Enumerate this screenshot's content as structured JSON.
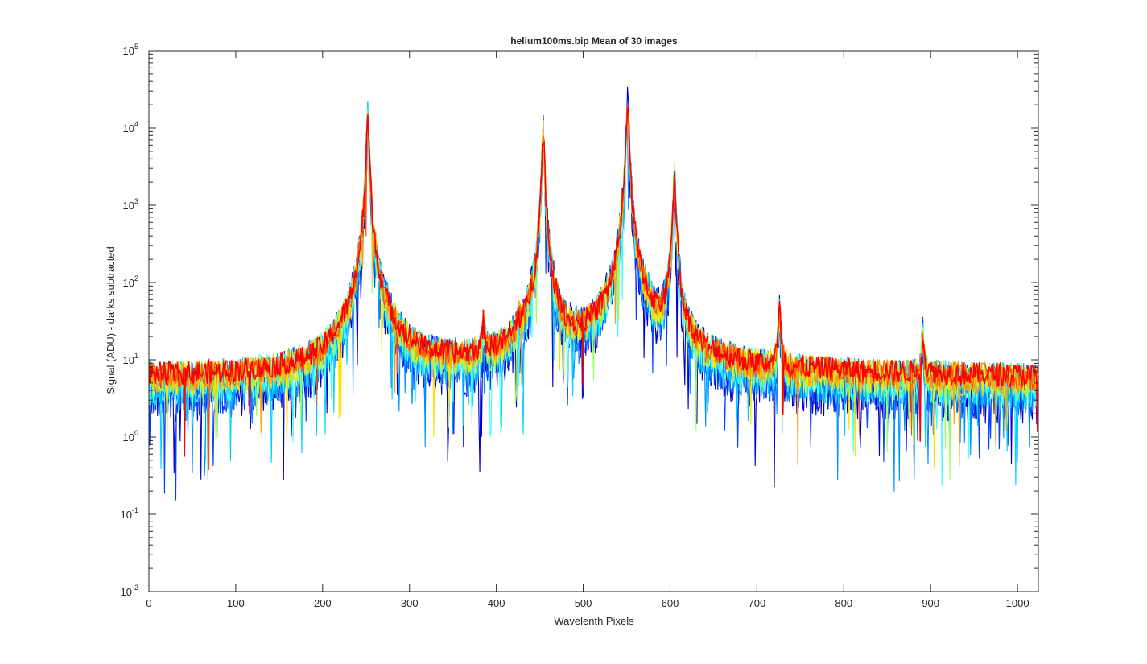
{
  "chart_data": {
    "type": "line",
    "title": "helium100ms.bip  Mean of 30 images",
    "xlabel": "Wavelenth Pixels",
    "ylabel": "Signal (ADU) - darks subtracted",
    "xlim": [
      0,
      1024
    ],
    "ylim": [
      0.01,
      100000
    ],
    "yscale": "log",
    "grid": false,
    "legend": "none",
    "x_ticks": [
      0,
      100,
      200,
      300,
      400,
      500,
      600,
      700,
      800,
      900,
      1000
    ],
    "x_tick_labels": [
      "0",
      "100",
      "200",
      "300",
      "400",
      "500",
      "600",
      "700",
      "800",
      "900",
      "1000"
    ],
    "y_ticks": [
      0.01,
      0.1,
      1,
      10,
      100,
      1000,
      10000,
      100000
    ],
    "y_tick_bases": [
      "10",
      "10",
      "10",
      "10",
      "10",
      "10",
      "10",
      "10"
    ],
    "y_tick_exponents": [
      "-2",
      "-1",
      "0",
      "1",
      "2",
      "3",
      "4",
      "5"
    ],
    "colormap": "jet",
    "series_colors": [
      "#0000c8",
      "#0040ff",
      "#0090ff",
      "#00d0ff",
      "#40ffff",
      "#a0ff60",
      "#ffe000",
      "#ffa000",
      "#ff5000",
      "#ff0000"
    ],
    "x_step": 1,
    "peaks": [
      {
        "x": 252,
        "y": 12000
      },
      {
        "x": 454,
        "y": 7500
      },
      {
        "x": 551,
        "y": 19000
      },
      {
        "x": 605,
        "y": 2400
      },
      {
        "x": 726,
        "y": 32
      },
      {
        "x": 891,
        "y": 13
      },
      {
        "x": 385,
        "y": 16
      },
      {
        "x": 425,
        "y": 14
      }
    ],
    "baseline": [
      {
        "x": 0,
        "y": 6
      },
      {
        "x": 200,
        "y": 6
      },
      {
        "x": 230,
        "y": 9
      },
      {
        "x": 270,
        "y": 13
      },
      {
        "x": 300,
        "y": 8
      },
      {
        "x": 440,
        "y": 8
      },
      {
        "x": 480,
        "y": 9
      },
      {
        "x": 530,
        "y": 12
      },
      {
        "x": 590,
        "y": 10
      },
      {
        "x": 640,
        "y": 7
      },
      {
        "x": 1024,
        "y": 6
      }
    ],
    "series": [
      {
        "values": []
      },
      {
        "values": []
      },
      {
        "values": []
      },
      {
        "values": []
      },
      {
        "values": []
      },
      {
        "values": []
      },
      {
        "values": []
      },
      {
        "values": []
      },
      {
        "values": []
      },
      {
        "values": []
      }
    ]
  }
}
